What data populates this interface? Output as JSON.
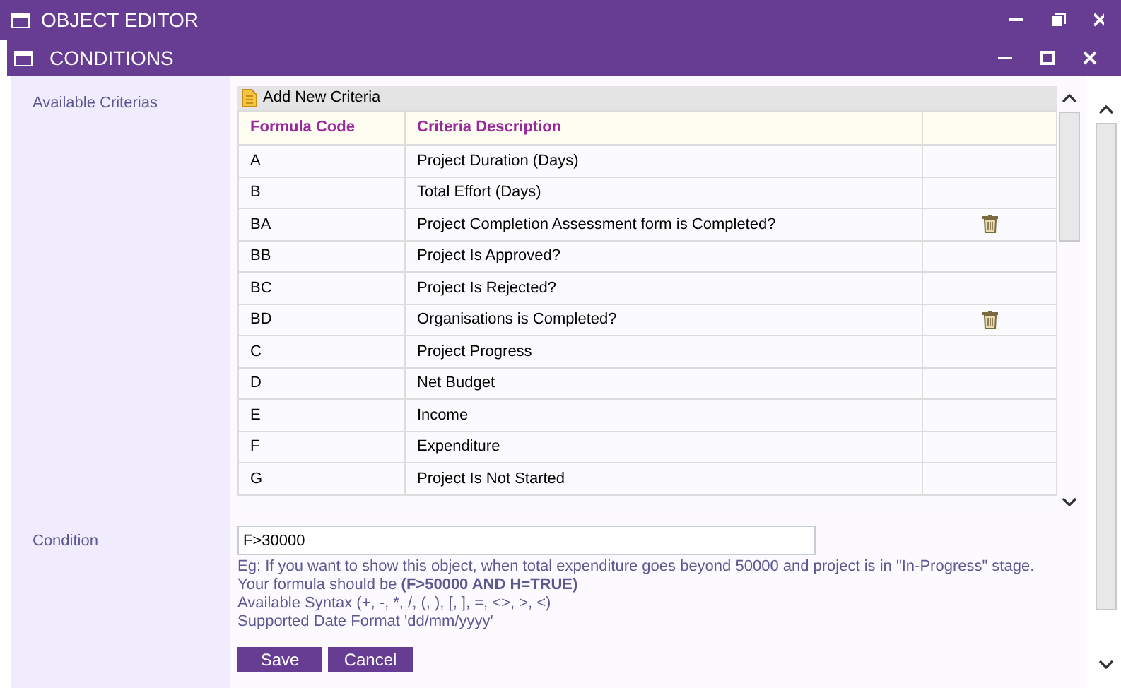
{
  "window": {
    "title": "OBJECT EDITOR"
  },
  "dialog": {
    "title": "CONDITIONS"
  },
  "criteria": {
    "label": "Available Criterias",
    "add_button": "Add New Criteria",
    "columns": [
      "Formula Code",
      "Criteria Description"
    ],
    "rows": [
      {
        "code": "A",
        "description": "Project Duration (Days)",
        "deletable": false
      },
      {
        "code": "B",
        "description": "Total Effort (Days)",
        "deletable": false
      },
      {
        "code": "BA",
        "description": "Project Completion Assessment form is Completed?",
        "deletable": true
      },
      {
        "code": "BB",
        "description": "Project Is Approved?",
        "deletable": false
      },
      {
        "code": "BC",
        "description": "Project Is Rejected?",
        "deletable": false
      },
      {
        "code": "BD",
        "description": "Organisations is Completed?",
        "deletable": true
      },
      {
        "code": "C",
        "description": "Project Progress",
        "deletable": false
      },
      {
        "code": "D",
        "description": "Net Budget",
        "deletable": false
      },
      {
        "code": "E",
        "description": "Income",
        "deletable": false
      },
      {
        "code": "F",
        "description": "Expenditure",
        "deletable": false
      },
      {
        "code": "G",
        "description": "Project Is Not Started",
        "deletable": false
      }
    ]
  },
  "condition": {
    "label": "Condition",
    "value": "F>30000",
    "help": [
      "Eg: If you want to show this object, when total expenditure goes beyond 50000 and project is in \"In-Progress\" stage.",
      "Your formula should be **(F>50000 AND H=TRUE)**",
      "Available Syntax (+, -, *, /, (, ), [, ], =, <>, >, <)",
      "Supported Date Format 'dd/mm/yyyy'"
    ]
  },
  "buttons": [
    "Save",
    "Cancel"
  ]
}
